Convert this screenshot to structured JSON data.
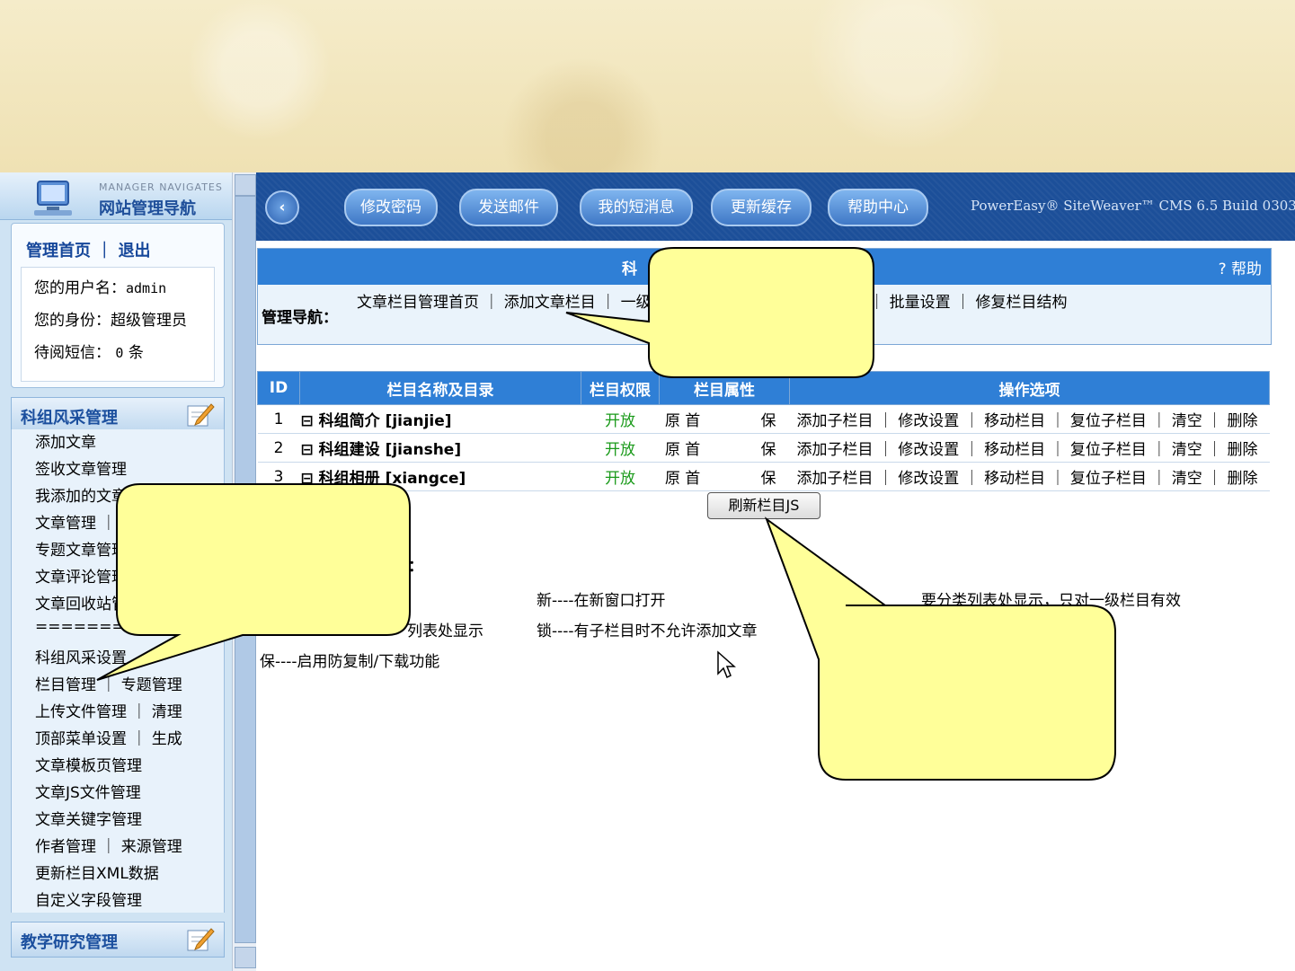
{
  "sidebar": {
    "header_en": "MANAGER NAVIGATES",
    "header_cn": "网站管理导航",
    "link_home": "管理首页",
    "link_logout": "退出",
    "username_label": "您的用户名：",
    "username": "admin",
    "role_label": "您的身份：",
    "role": "超级管理员",
    "msgs_label": "待阅短信：",
    "msgs_count": "0",
    "msgs_unit": "条",
    "section1": "科组风采管理",
    "section2": "教学研究管理",
    "menu": [
      "添加文章",
      "签收文章管理",
      "我添加的文章",
      "文章管理 ｜",
      "专题文章管理",
      "文章评论管理",
      "文章回收站管",
      "==============",
      "科组风采设置",
      "栏目管理 ｜ 专题管理",
      "上传文件管理 ｜ 清理",
      "顶部菜单设置 ｜ 生成",
      "文章模板页管理",
      "文章JS文件管理",
      "文章关键字管理",
      "作者管理 ｜ 来源管理",
      "更新栏目XML数据",
      "自定义字段管理"
    ]
  },
  "topbar": {
    "back_icon": "‹",
    "buttons": [
      "修改密码",
      "发送邮件",
      "我的短消息",
      "更新缓存",
      "帮助中心"
    ],
    "brand": "PowerEasy® SiteWeaver™ CMS 6.5 Build 0303"
  },
  "nav": {
    "title": "科",
    "help": "帮助",
    "label": "管理导航：",
    "links": "文章栏目管理首页 ｜ 添加文章栏目 ｜ 一级 所有文章栏目 ｜ 文章栏目合并 ｜ 批量设置 ｜ 修复栏目结构"
  },
  "table": {
    "headers": [
      "ID",
      "栏目名称及目录",
      "栏目权限",
      "栏目属性",
      "操作选项"
    ],
    "rows": [
      {
        "id": "1",
        "name": "⊟ 科组简介 [jianjie]",
        "perm": "开放",
        "attr": "原 首",
        "attr2": "保",
        "ops": "添加子栏目 ｜ 修改设置 ｜ 移动栏目 ｜ 复位子栏目 ｜ 清空 ｜ 删除"
      },
      {
        "id": "2",
        "name": "⊟ 科组建设 [jianshe]",
        "perm": "开放",
        "attr": "原 首",
        "attr2": "保",
        "ops": "添加子栏目 ｜ 修改设置 ｜ 移动栏目 ｜ 复位子栏目 ｜ 清空 ｜ 删除"
      },
      {
        "id": "3",
        "name": "⊟ 科组相册 [xiangce]",
        "perm": "开放",
        "attr": "原 首",
        "attr2": "保",
        "ops": "添加子栏目 ｜ 修改设置 ｜ 移动栏目 ｜ 复位子栏目 ｜ 清空 ｜ 删除"
      }
    ]
  },
  "refresh_btn": "刷新栏目JS",
  "legend": {
    "heading": "义：",
    "new": "新----在新窗口打开",
    "first": "首",
    "first_desc": "要分类列表处显示，只对一级栏目有效",
    "list": "列表处显示",
    "lock": "锁----有子栏目时不允许添加文章",
    "protect": "保----启用防复制/下载功能"
  },
  "colors": {
    "accent": "#2f7fd6",
    "callout": "#ffff99"
  }
}
